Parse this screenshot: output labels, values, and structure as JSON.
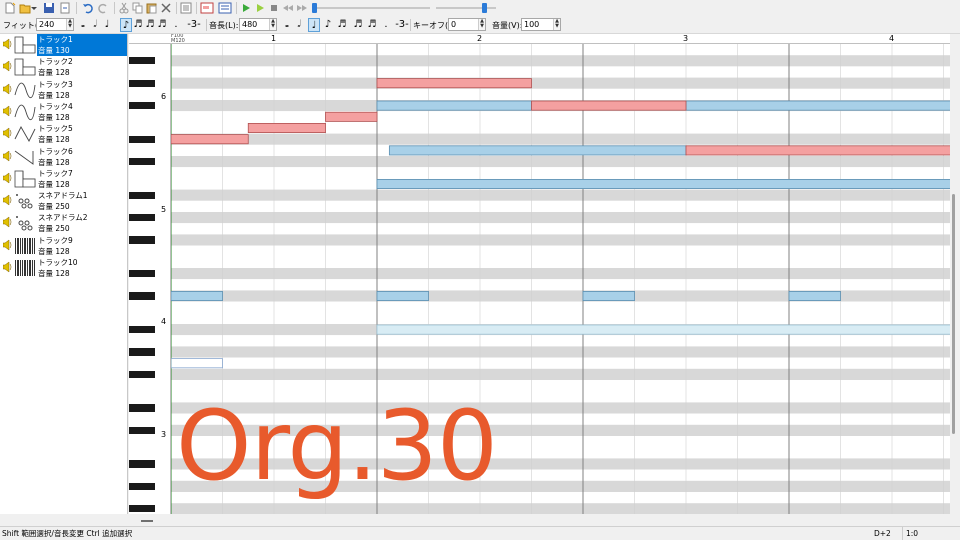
{
  "toolbar2": {
    "fit_label": "フィット(F):",
    "fit_value": "240",
    "length_label": "音長(L):",
    "length_value": "480",
    "keyoff_label": "キーオフ(K):",
    "keyoff_value": "0",
    "volume_label": "音量(V):",
    "volume_value": "100"
  },
  "tracks": [
    {
      "name": "トラック1",
      "volume": "音量 130",
      "icon": "square-wave-icon",
      "selected": true
    },
    {
      "name": "トラック2",
      "volume": "音量 128",
      "icon": "square-wave-icon"
    },
    {
      "name": "トラック3",
      "volume": "音量 128",
      "icon": "sine-wave-icon"
    },
    {
      "name": "トラック4",
      "volume": "音量 128",
      "icon": "sine-wave-icon"
    },
    {
      "name": "トラック5",
      "volume": "音量 128",
      "icon": "triangle-wave-icon"
    },
    {
      "name": "トラック6",
      "volume": "音量 128",
      "icon": "sawtooth-wave-icon"
    },
    {
      "name": "トラック7",
      "volume": "音量 128",
      "icon": "square-wave-icon"
    },
    {
      "name": "スネアドラム1",
      "volume": "音量 250",
      "icon": "drum-icon"
    },
    {
      "name": "スネアドラム2",
      "volume": "音量 250",
      "icon": "drum-icon"
    },
    {
      "name": "トラック9",
      "volume": "音量 128",
      "icon": "noise-wave-icon"
    },
    {
      "name": "トラック10",
      "volume": "音量 128",
      "icon": "noise-wave-icon"
    }
  ],
  "ruler": {
    "tempo_top": "F100",
    "tempo_bottom": "M120",
    "bars": [
      "1",
      "2",
      "3",
      "4"
    ]
  },
  "octaves": [
    "6",
    "5",
    "4",
    "3"
  ],
  "notes": {
    "colors": {
      "red": "#f4a0a0",
      "blue": "#a8d0e8",
      "light": "#d8ecf4"
    },
    "red": [
      {
        "row": 3,
        "start": 2.0,
        "len": 0.75
      },
      {
        "row": 5,
        "start": 2.75,
        "len": 0.75
      },
      {
        "row": 6,
        "start": 1.75,
        "len": 0.25
      },
      {
        "row": 7,
        "start": 1.375,
        "len": 0.375
      },
      {
        "row": 8,
        "start": 1.0,
        "len": 0.375
      },
      {
        "row": 9,
        "start": 3.5,
        "len": 1.3
      }
    ],
    "blue": [
      {
        "row": 5,
        "start": 2.0,
        "len": 0.75
      },
      {
        "row": 5,
        "start": 3.5,
        "len": 1.3
      },
      {
        "row": 9,
        "start": 2.06,
        "len": 1.44
      },
      {
        "row": 12,
        "start": 2.0,
        "len": 2.8
      },
      {
        "row": 22,
        "start": 1.0,
        "len": 0.25
      },
      {
        "row": 22,
        "start": 2.0,
        "len": 0.25
      },
      {
        "row": 22,
        "start": 3.0,
        "len": 0.25
      },
      {
        "row": 22,
        "start": 4.0,
        "len": 0.25
      }
    ],
    "light": [
      {
        "row": 25,
        "start": 2.0,
        "len": 2.8
      }
    ],
    "outline": [
      {
        "row": 28,
        "start": 1.0,
        "len": 0.25
      }
    ]
  },
  "status": {
    "hint": "Shift 範囲選択/音長変更  Ctrl 追加選択",
    "key": "D+2",
    "position": "1:0"
  },
  "watermark": "Org.30"
}
